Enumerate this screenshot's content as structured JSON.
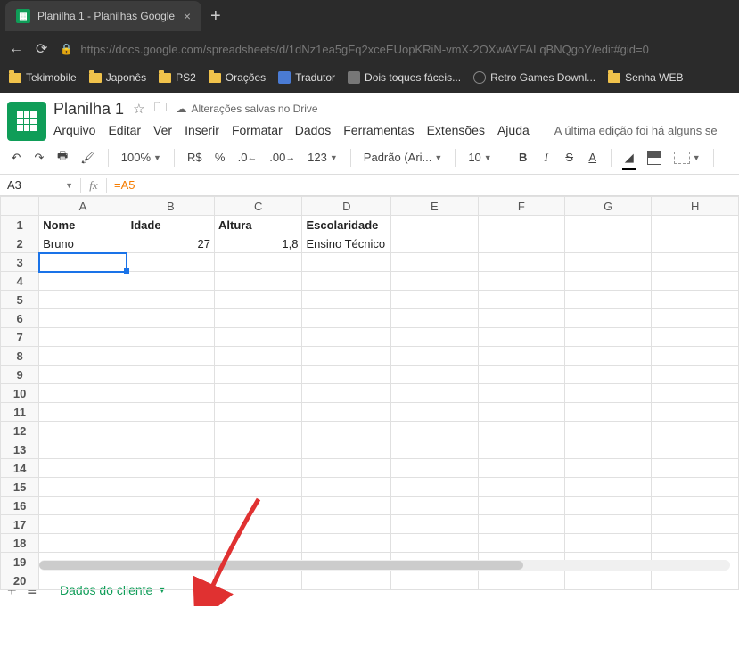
{
  "browser": {
    "tab_title": "Planilha 1 - Planilhas Google",
    "url_host": "https://docs.google.com",
    "url_path": "/spreadsheets/d/1dNz1ea5gFq2xceEUopKRiN-vmX-2OXwAYFALqBNQgoY/edit#gid=0",
    "bookmarks": [
      "Tekimobile",
      "Japonês",
      "PS2",
      "Orações",
      "Tradutor",
      "Dois toques fáceis...",
      "Retro Games Downl...",
      "Senha WEB"
    ]
  },
  "doc": {
    "title": "Planilha 1",
    "save_status": "Alterações salvas no Drive",
    "menus": [
      "Arquivo",
      "Editar",
      "Ver",
      "Inserir",
      "Formatar",
      "Dados",
      "Ferramentas",
      "Extensões",
      "Ajuda"
    ],
    "last_edit": "A última edição foi há alguns se"
  },
  "toolbar": {
    "zoom": "100%",
    "currency": "R$",
    "percent": "%",
    "dec_less": ".0",
    "dec_more": ".00",
    "numfmt": "123",
    "font": "Padrão (Ari...",
    "font_size": "10",
    "bold": "B",
    "italic": "I",
    "strike": "S",
    "textcolor": "A"
  },
  "formula": {
    "cell_ref": "A3",
    "fx": "fx",
    "content": "=A5"
  },
  "grid": {
    "columns": [
      "A",
      "B",
      "C",
      "D",
      "E",
      "F",
      "G",
      "H"
    ],
    "rows": 20,
    "data": {
      "A1": "Nome",
      "B1": "Idade",
      "C1": "Altura",
      "D1": "Escolaridade",
      "A2": "Bruno",
      "B2": "27",
      "C2": "1,8",
      "D2": "Ensino Técnico"
    },
    "bold": [
      "A1",
      "B1",
      "C1",
      "D1"
    ],
    "numeric": [
      "B2",
      "C2"
    ],
    "active": "A3"
  },
  "sheet_tabs": {
    "active": "Dados do cliente"
  }
}
